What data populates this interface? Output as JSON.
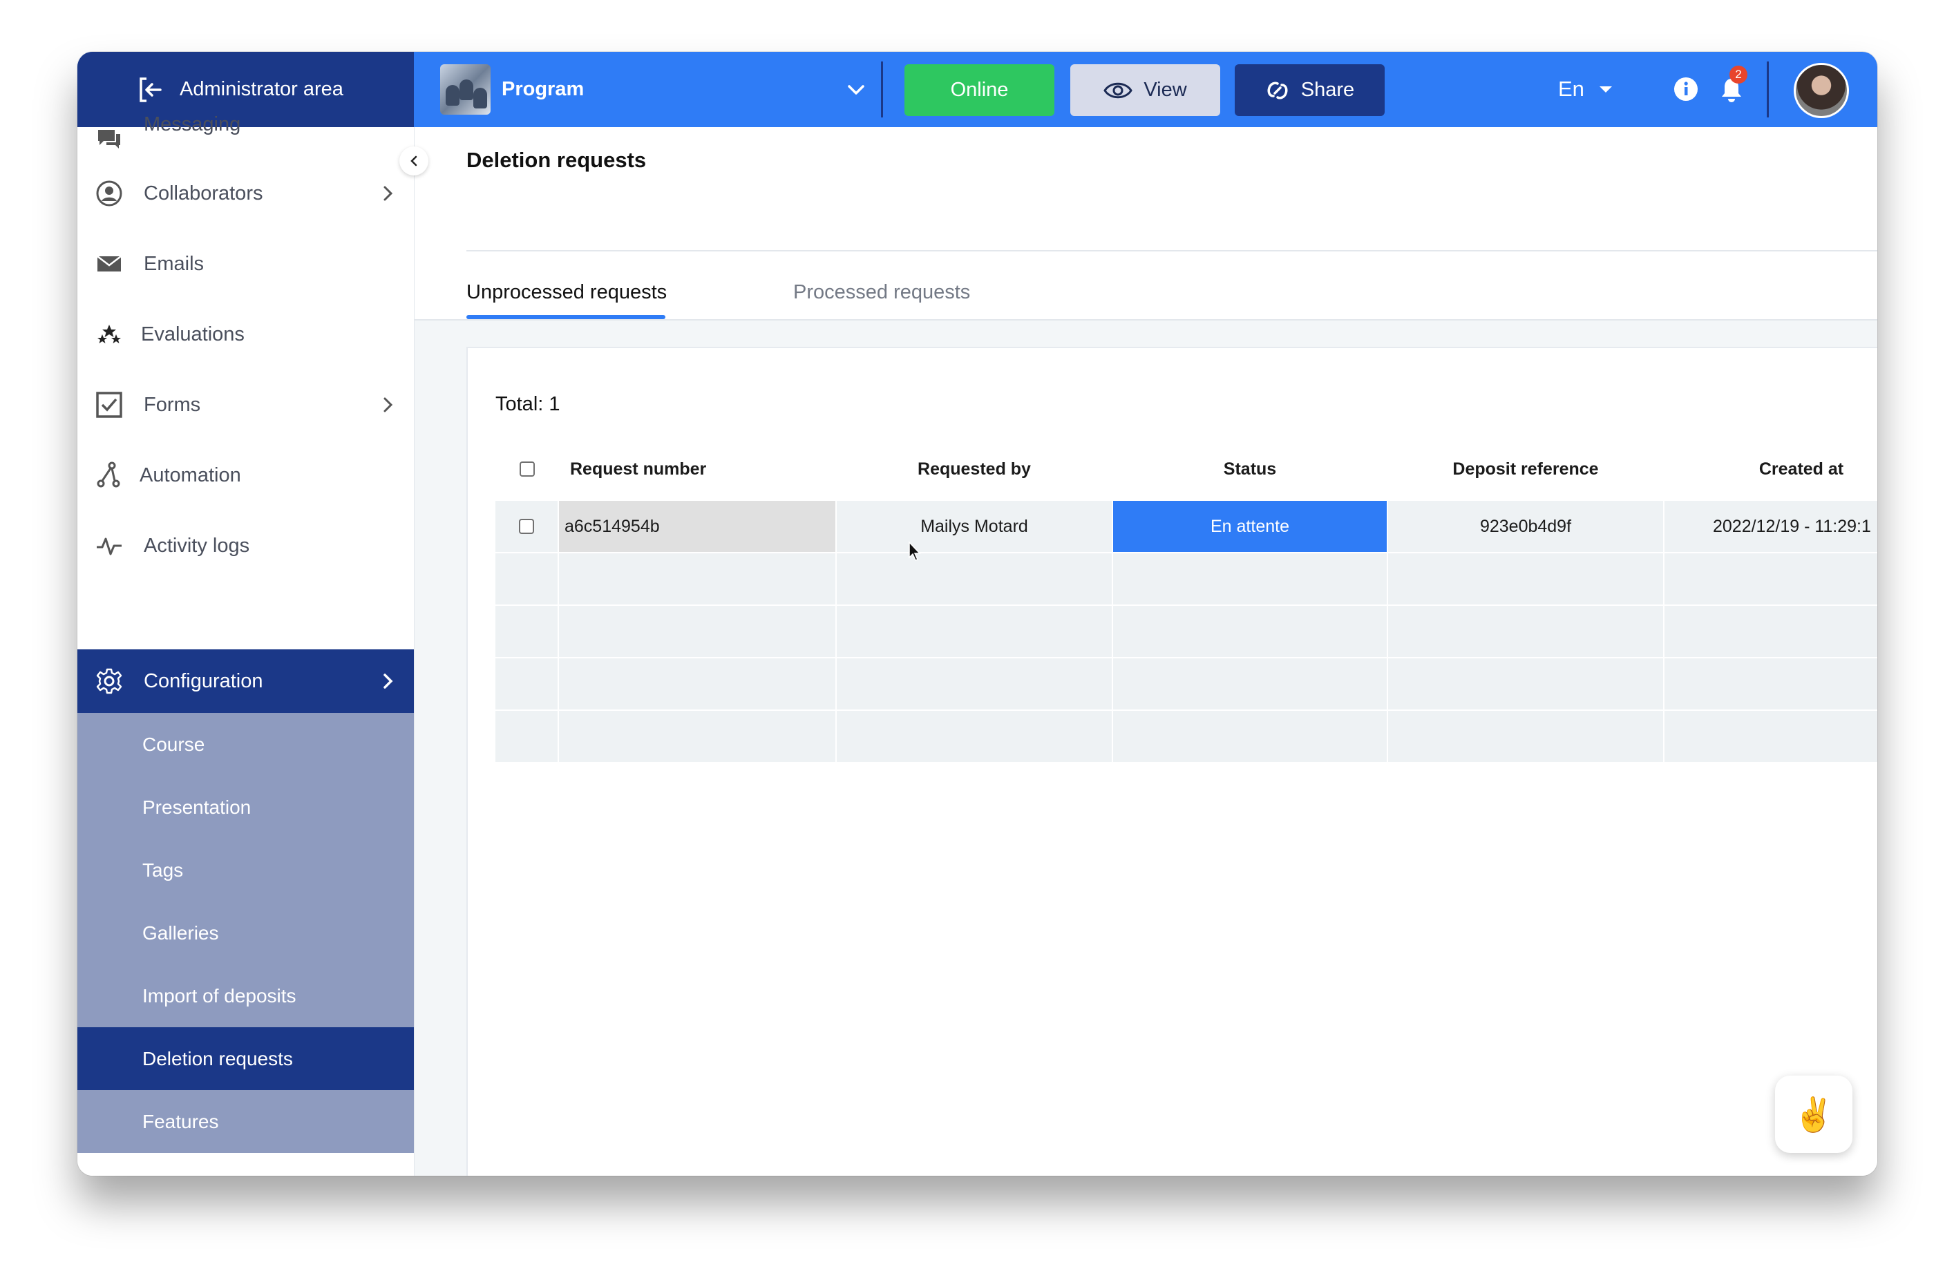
{
  "topbar": {
    "admin_label": "Administrator area",
    "program_label": "Program",
    "online_label": "Online",
    "view_label": "View",
    "share_label": "Share",
    "language": "En",
    "notification_count": "2"
  },
  "sidebar": {
    "items": [
      {
        "label": "Messaging"
      },
      {
        "label": "Collaborators"
      },
      {
        "label": "Emails"
      },
      {
        "label": "Evaluations"
      },
      {
        "label": "Forms"
      },
      {
        "label": "Automation"
      },
      {
        "label": "Activity logs"
      },
      {
        "label": "Configuration"
      }
    ],
    "sub_items": [
      {
        "label": "Course"
      },
      {
        "label": "Presentation"
      },
      {
        "label": "Tags"
      },
      {
        "label": "Galleries"
      },
      {
        "label": "Import of deposits"
      },
      {
        "label": "Deletion requests"
      },
      {
        "label": "Features"
      }
    ]
  },
  "main": {
    "title": "Deletion requests",
    "tabs": [
      {
        "label": "Unprocessed requests"
      },
      {
        "label": "Processed requests"
      }
    ],
    "total_label": "Total: 1",
    "table": {
      "columns": [
        "Request number",
        "Requested by",
        "Status",
        "Deposit reference",
        "Created at"
      ],
      "rows": [
        [
          "a6c514954b",
          "Mailys Motard",
          "En attente",
          "923e0b4d9f",
          "2022/12/19 - 11:29:1"
        ]
      ]
    },
    "help_emoji": "✌️"
  },
  "colors": {
    "brand_blue": "#2f7cf6",
    "navy": "#1b3888",
    "online_green": "#2ec760",
    "submenu_bg": "#8e9bbf"
  }
}
